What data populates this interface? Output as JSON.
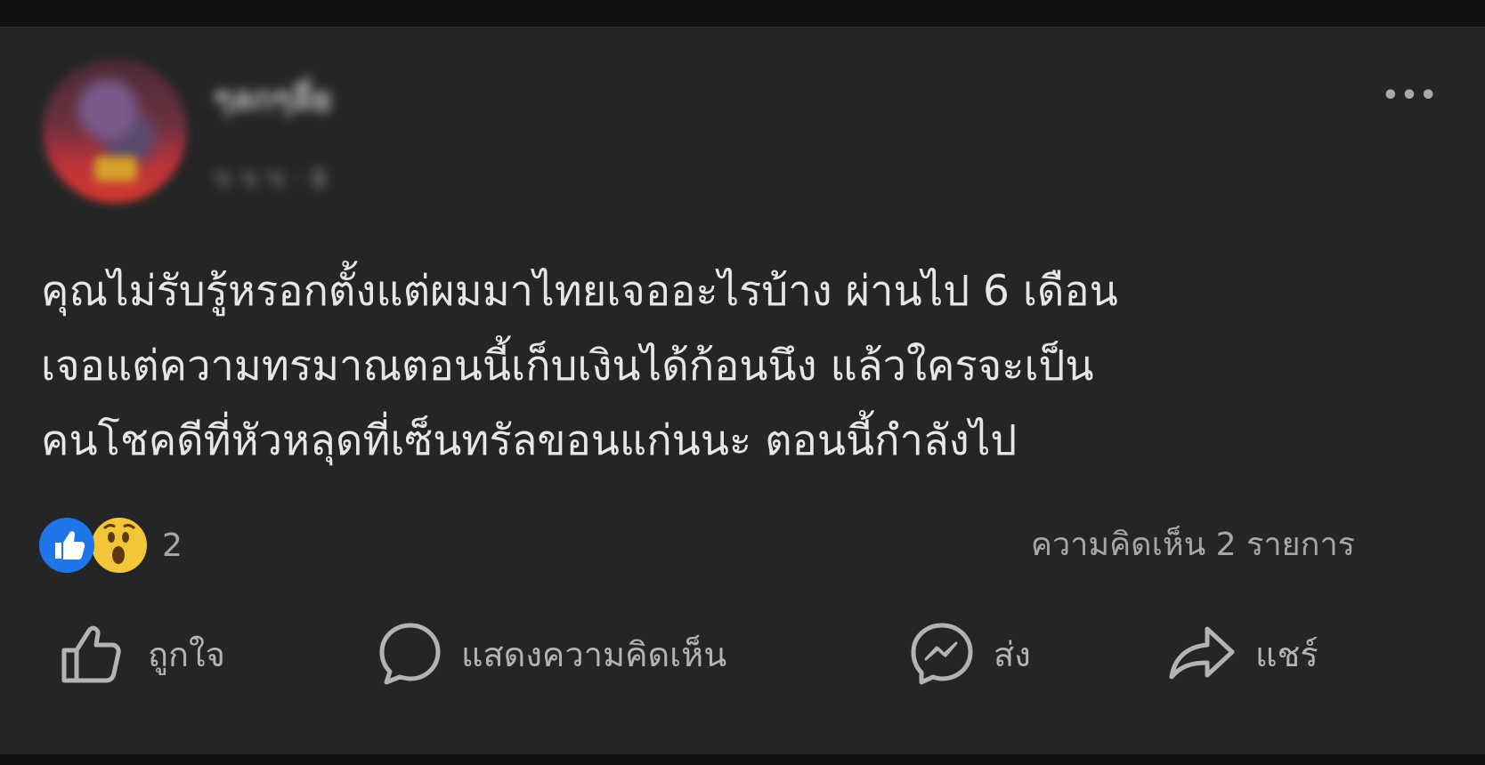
{
  "post": {
    "author_name": "ๆลกๆลี่ย",
    "meta": "ข ข ข · ฿",
    "more_label": "•••",
    "text_lines": [
      "คุณไม่รับรู้หรอกตั้งแต่ผมมาไทยเจออะไรบ้าง ผ่านไป 6 เดือน",
      "เจอแต่ความทรมาณตอนนี้เก็บเงินได้ก้อนนึง แล้วใครจะเป็น",
      "คนโชคดีที่หัวหลุดที่เซ็นทรัลขอนแก่นนะ ตอนนี้กำลังไป"
    ]
  },
  "reactions": {
    "icons": [
      "like-icon",
      "wow-icon"
    ],
    "count": "2"
  },
  "comments": {
    "count_label": "ความคิดเห็น 2 รายการ"
  },
  "actions": {
    "like": "ถูกใจ",
    "comment": "แสดงความคิดเห็น",
    "send": "ส่ง",
    "share": "แชร์"
  },
  "colors": {
    "background": "#242526",
    "text": "#e6e6e6",
    "secondary_text": "#a7a7a7",
    "like_blue": "#1f76e8",
    "wow_yellow": "#f3c63a"
  }
}
